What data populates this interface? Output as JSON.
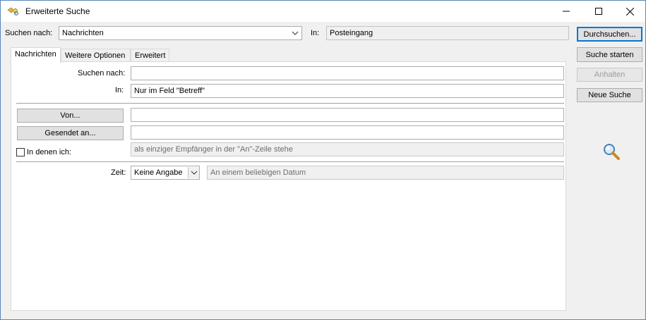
{
  "window": {
    "title": "Erweiterte Suche"
  },
  "top": {
    "search_for_label": "Suchen nach:",
    "search_for_value": "Nachrichten",
    "in_label": "In:",
    "in_value": "Posteingang"
  },
  "tabs": [
    {
      "label": "Nachrichten",
      "active": true
    },
    {
      "label": "Weitere Optionen",
      "active": false
    },
    {
      "label": "Erweitert",
      "active": false
    }
  ],
  "form": {
    "search_label": "Suchen nach:",
    "search_value": "",
    "in_label": "In:",
    "in_value": "Nur im Feld \"Betreff\"",
    "from_button": "Von...",
    "from_value": "",
    "sent_to_button": "Gesendet an...",
    "sent_to_value": "",
    "where_i_am_label": "In denen ich:",
    "where_i_am_checked": false,
    "where_i_am_value": "als einziger Empfänger in der \"An\"-Zeile stehe",
    "time_label": "Zeit:",
    "time_value": "Keine Angabe",
    "date_value": "An einem beliebigen Datum"
  },
  "buttons": {
    "browse": "Durchsuchen...",
    "start": "Suche starten",
    "stop": "Anhalten",
    "new": "Neue Suche"
  },
  "icons": {
    "magnifier": "magnifier-icon",
    "app": "search-folder-icon"
  },
  "colors": {
    "window_border": "#5a86b8",
    "button_face": "#e1e1e1"
  }
}
